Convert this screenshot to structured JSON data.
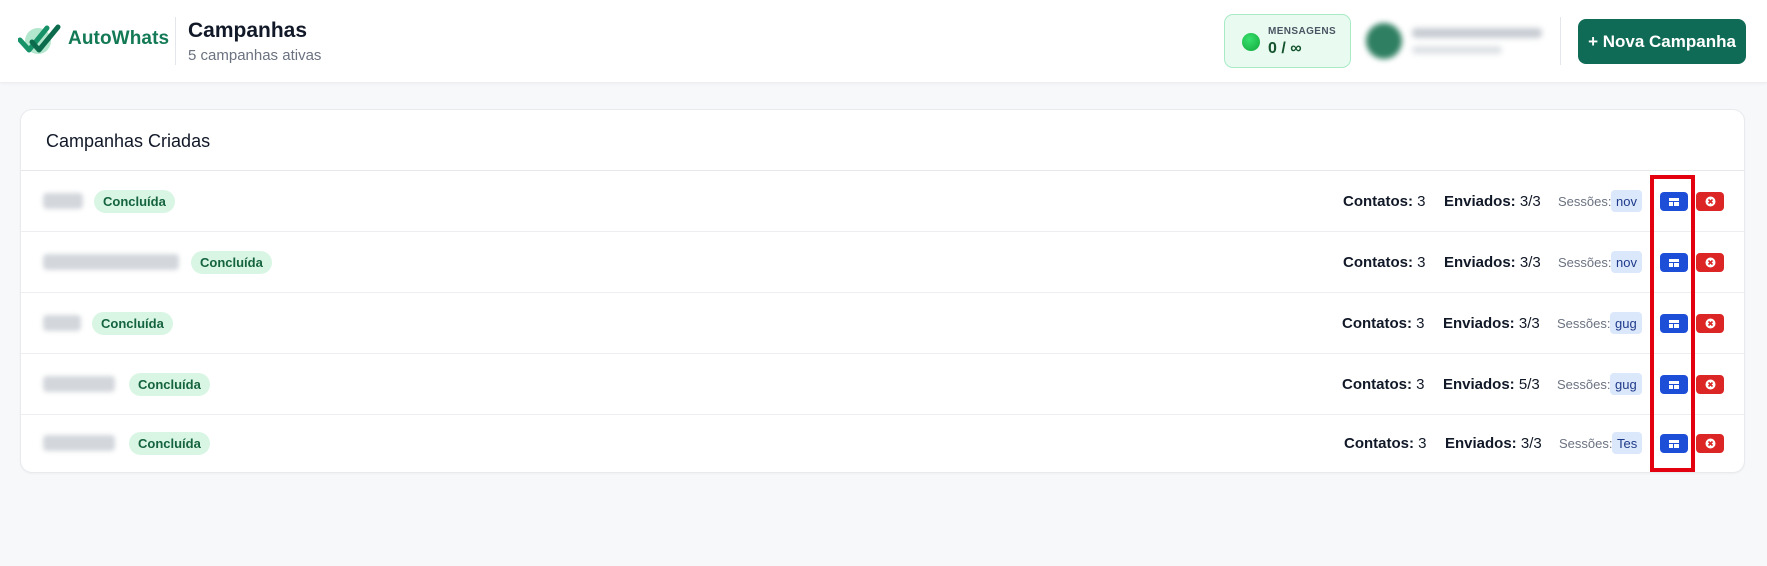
{
  "brand": {
    "name": "AutoWhats",
    "color": "#137a55"
  },
  "header": {
    "title": "Campanhas",
    "subtitle": "5 campanhas ativas",
    "messages": {
      "label": "MENSAGENS",
      "value": "0 / ∞"
    },
    "new_campaign_button": "+ Nova Campanha"
  },
  "card": {
    "title": "Campanhas Criadas",
    "contacts_label": "Contatos:",
    "sent_label": "Enviados:",
    "sessions_label": "Sessões:",
    "rows": [
      {
        "status": "Concluída",
        "contacts": "3",
        "sent": "3/3",
        "session": "nov"
      },
      {
        "status": "Concluída",
        "contacts": "3",
        "sent": "3/3",
        "session": "nov"
      },
      {
        "status": "Concluída",
        "contacts": "3",
        "sent": "3/3",
        "session": "gug"
      },
      {
        "status": "Concluída",
        "contacts": "3",
        "sent": "5/3",
        "session": "gug"
      },
      {
        "status": "Concluída",
        "contacts": "3",
        "sent": "3/3",
        "session": "Tes"
      }
    ]
  },
  "icons": {
    "logo": "double-check-logo-icon",
    "status_dot": "green-dot-icon",
    "view": "dashboard-icon",
    "delete": "close-circle-icon"
  },
  "colors": {
    "primary_button": "#0f6b55",
    "view_button": "#1d4ed8",
    "delete_button": "#dc2626",
    "highlight": "#e3000f"
  }
}
